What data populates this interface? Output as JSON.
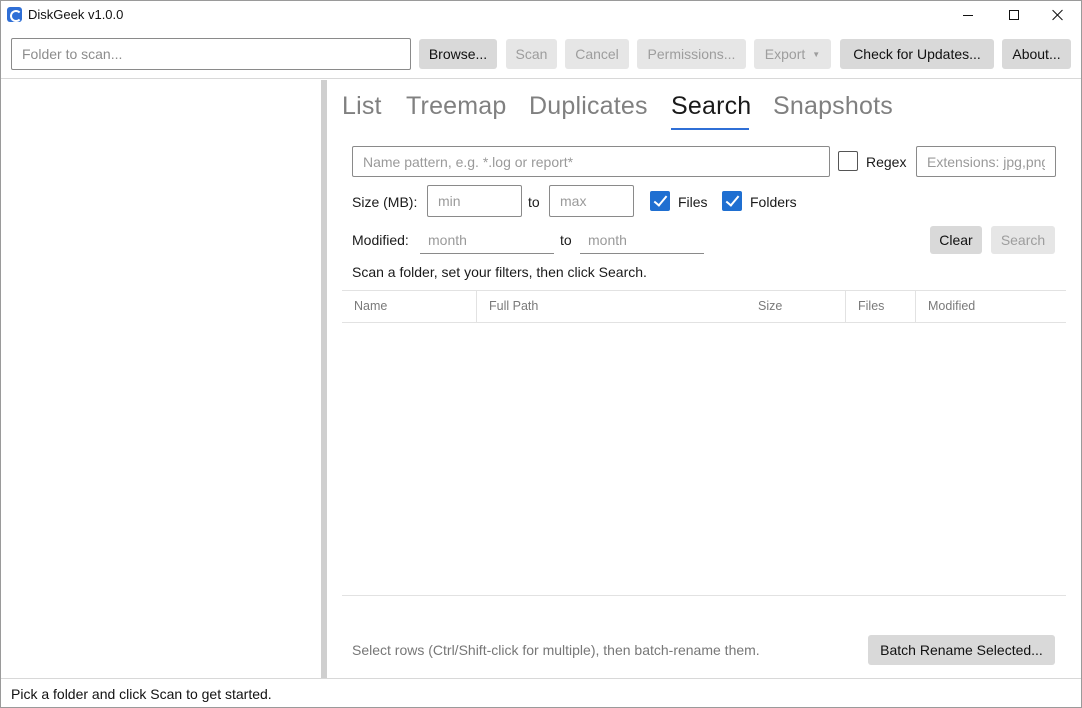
{
  "window": {
    "title": "DiskGeek v1.0.0",
    "icon": "app-icon",
    "controls": [
      "minimize-icon",
      "maximize-icon",
      "close-icon"
    ]
  },
  "toolbar": {
    "folder_placeholder": "Folder to scan...",
    "browse_label": "Browse...",
    "scan_label": "Scan",
    "cancel_label": "Cancel",
    "permissions_label": "Permissions...",
    "export_label": "Export",
    "export_caret": "▼",
    "updates_label": "Check for Updates...",
    "about_label": "About..."
  },
  "tabs": [
    {
      "label": "List"
    },
    {
      "label": "Treemap"
    },
    {
      "label": "Duplicates"
    },
    {
      "label": "Search",
      "active": true
    },
    {
      "label": "Snapshots"
    }
  ],
  "search": {
    "name_placeholder": "Name pattern, e.g. *.log or report*",
    "regex_label": "Regex",
    "regex_checked": false,
    "extensions_placeholder": "Extensions: jpg,png",
    "size_label": "Size (MB):",
    "min_placeholder": "min",
    "to_label": "to",
    "max_placeholder": "max",
    "files_label": "Files",
    "files_checked": true,
    "folders_label": "Folders",
    "folders_checked": true,
    "modified_label": "Modified:",
    "month_from_placeholder": "month",
    "month_to_placeholder": "month",
    "clear_label": "Clear",
    "search_label": "Search",
    "hint": "Scan a folder, set your filters, then click Search."
  },
  "results": {
    "columns": [
      "Name",
      "Full Path",
      "Size",
      "Files",
      "Modified"
    ],
    "rows": []
  },
  "footer": {
    "hint": "Select rows (Ctrl/Shift-click for multiple), then batch-rename them.",
    "batch_label": "Batch Rename Selected..."
  },
  "status": {
    "text": "Pick a folder and click Scan to get started."
  },
  "colors": {
    "accent": "#2f6fd6",
    "checkbox": "#1f6fd1",
    "button_bg": "#d9d9d9",
    "button_disabled_bg": "#e6e6e6",
    "disabled_text": "#9d9d9d",
    "splitter": "#cfcfcf"
  }
}
